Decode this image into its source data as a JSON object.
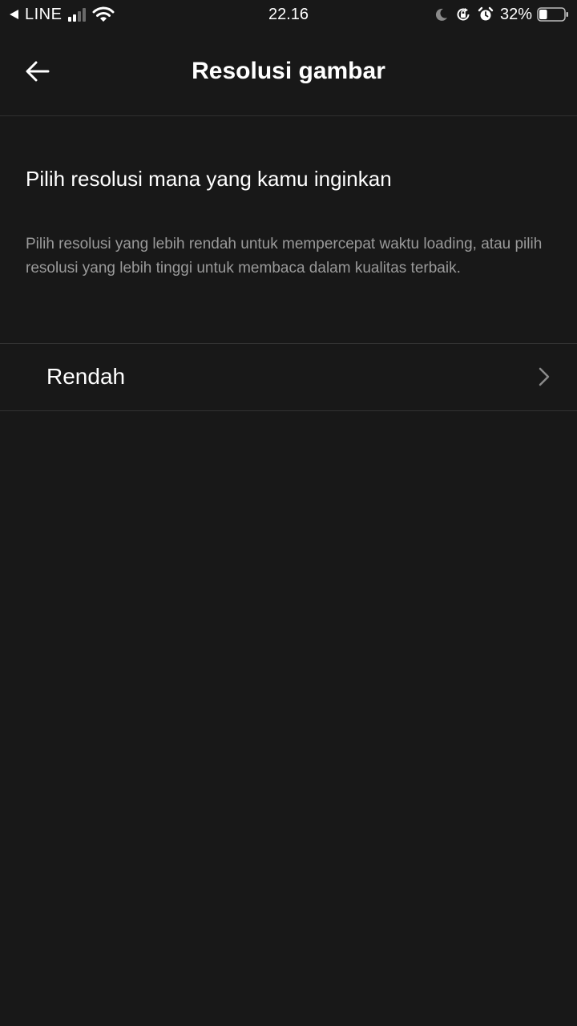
{
  "status_bar": {
    "carrier": "LINE",
    "time": "22.16",
    "battery_percent": "32%",
    "battery_level": 0.32,
    "icons": [
      "back-to-app-icon",
      "signal-icon",
      "wifi-icon",
      "moon-icon",
      "orientation-lock-icon",
      "alarm-icon",
      "battery-icon"
    ]
  },
  "header": {
    "title": "Resolusi gambar",
    "back_icon": "arrow-left-icon"
  },
  "content": {
    "heading": "Pilih resolusi mana yang kamu inginkan",
    "description": "Pilih resolusi yang lebih rendah untuk mempercepat waktu loading, atau pilih resolusi yang lebih tinggi untuk membaca dalam kualitas terbaik."
  },
  "option": {
    "label": "Rendah",
    "icon": "chevron-right-icon"
  },
  "colors": {
    "background": "#181818",
    "text_primary": "#ffffff",
    "text_secondary": "#9a9a9a",
    "divider": "#333333"
  }
}
